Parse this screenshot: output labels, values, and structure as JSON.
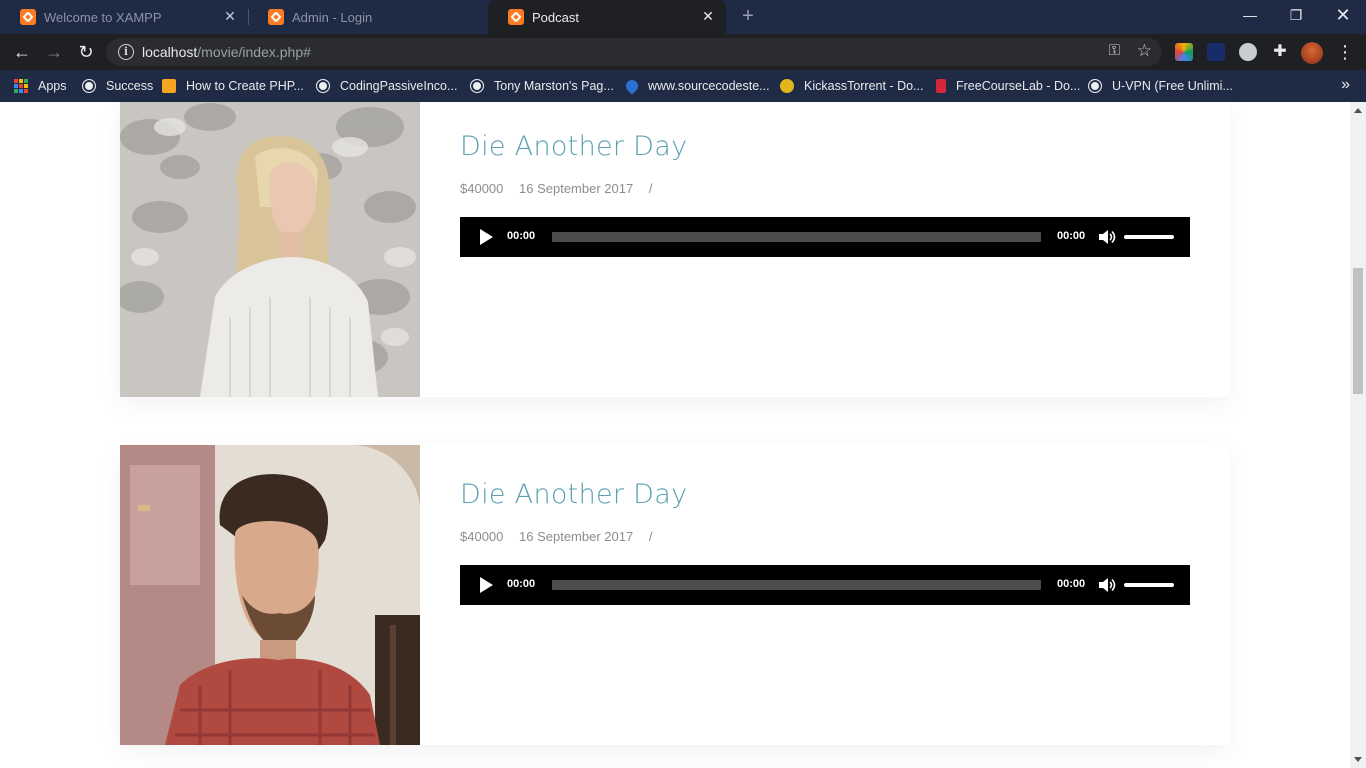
{
  "browser": {
    "tabs": [
      {
        "title": "Welcome to XAMPP",
        "active": false
      },
      {
        "title": "Admin - Login",
        "active": false
      },
      {
        "title": "Podcast",
        "active": true
      }
    ],
    "url_host": "localhost",
    "url_path": "/movie/index.php#",
    "bookmarks": [
      {
        "label": "Apps"
      },
      {
        "label": "Success"
      },
      {
        "label": "How to Create PHP..."
      },
      {
        "label": "CodingPassiveInco..."
      },
      {
        "label": "Tony Marston's Pag..."
      },
      {
        "label": "www.sourcecodeste..."
      },
      {
        "label": "KickassTorrent - Do..."
      },
      {
        "label": "FreeCourseLab - Do..."
      },
      {
        "label": "U-VPN (Free Unlimi..."
      }
    ]
  },
  "page": {
    "episodes": [
      {
        "title": "Die Another Day",
        "price": "$40000",
        "date": "16 September 2017",
        "separator": "/",
        "current_time": "00:00",
        "duration": "00:00"
      },
      {
        "title": "Die Another Day",
        "price": "$40000",
        "date": "16 September 2017",
        "separator": "/",
        "current_time": "00:00",
        "duration": "00:00"
      }
    ]
  }
}
